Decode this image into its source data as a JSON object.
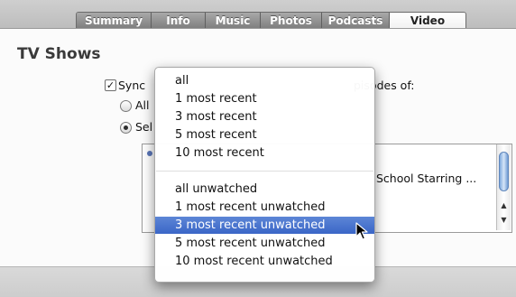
{
  "tabs": [
    {
      "label": "Summary",
      "active": false
    },
    {
      "label": "Info",
      "active": false
    },
    {
      "label": "Music",
      "active": false
    },
    {
      "label": "Photos",
      "active": false
    },
    {
      "label": "Podcasts",
      "active": false
    },
    {
      "label": "Video",
      "active": true
    }
  ],
  "section": {
    "title": "TV Shows",
    "sync_label": "Sync",
    "sync_checked": true,
    "episodes_label": "pisodes of:",
    "radio_all_label": "All",
    "radio_selected_label": "Sel"
  },
  "list": {
    "row_text": "School Starring ..."
  },
  "menu": {
    "group1": [
      "all",
      "1 most recent",
      "3 most recent",
      "5 most recent",
      "10 most recent"
    ],
    "group2": [
      "all unwatched",
      "1 most recent unwatched",
      "3 most recent unwatched",
      "5 most recent unwatched",
      "10 most recent unwatched"
    ],
    "highlighted": "3 most recent unwatched"
  },
  "icons": {
    "check": "check-icon",
    "cursor": "arrow-cursor-icon"
  },
  "colors": {
    "menu_highlight": "#3a66c7",
    "scroll_thumb": "#7fa9dd"
  }
}
